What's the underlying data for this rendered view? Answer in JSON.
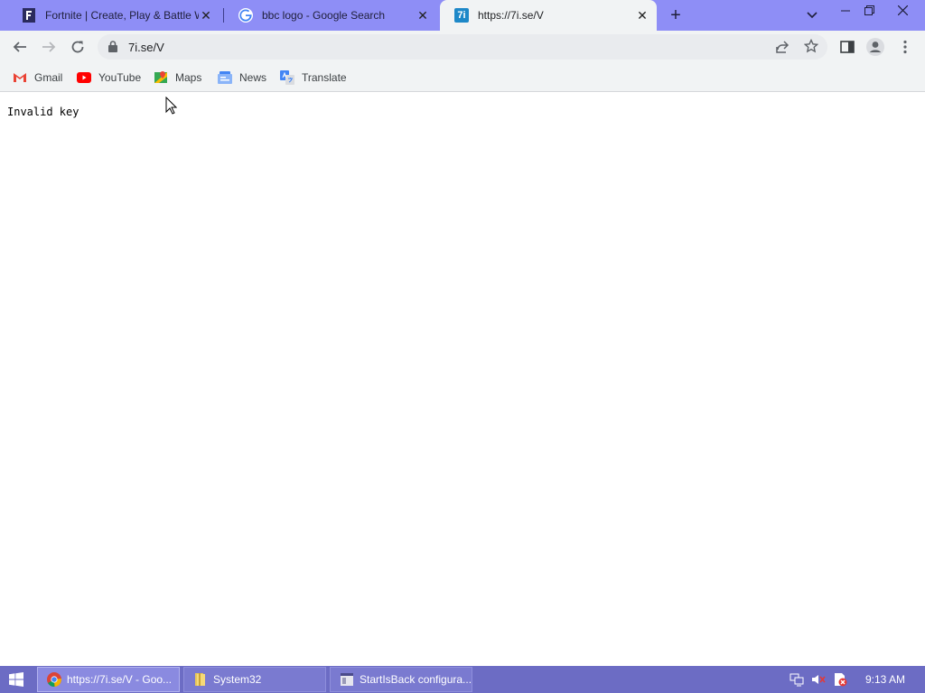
{
  "browser": {
    "tabs": [
      {
        "title": "Fortnite | Create, Play & Battle W",
        "active": false,
        "icon": "fortnite-icon"
      },
      {
        "title": "bbc logo - Google Search",
        "active": false,
        "icon": "google-icon"
      },
      {
        "title": "https://7i.se/V",
        "active": true,
        "icon": "7i-site-icon",
        "icon_text": "7i"
      }
    ],
    "new_tab_label": "+",
    "address": "7i.se/V",
    "bookmarks": [
      {
        "label": "Gmail",
        "icon": "gmail-icon"
      },
      {
        "label": "YouTube",
        "icon": "youtube-icon"
      },
      {
        "label": "Maps",
        "icon": "maps-icon"
      },
      {
        "label": "News",
        "icon": "news-icon"
      },
      {
        "label": "Translate",
        "icon": "translate-icon"
      }
    ]
  },
  "page": {
    "message": "Invalid key"
  },
  "taskbar": {
    "items": [
      {
        "label": "https://7i.se/V - Goo...",
        "icon": "chrome-icon",
        "active": true
      },
      {
        "label": "System32",
        "icon": "folder-icon",
        "active": false
      },
      {
        "label": "StartIsBack configura...",
        "icon": "settings-window-icon",
        "active": false
      }
    ],
    "clock": "9:13 AM"
  },
  "colors": {
    "tabstrip": "#8e8ef6",
    "toolbar": "#f1f3f4",
    "taskbar": "#6c6cc4"
  }
}
